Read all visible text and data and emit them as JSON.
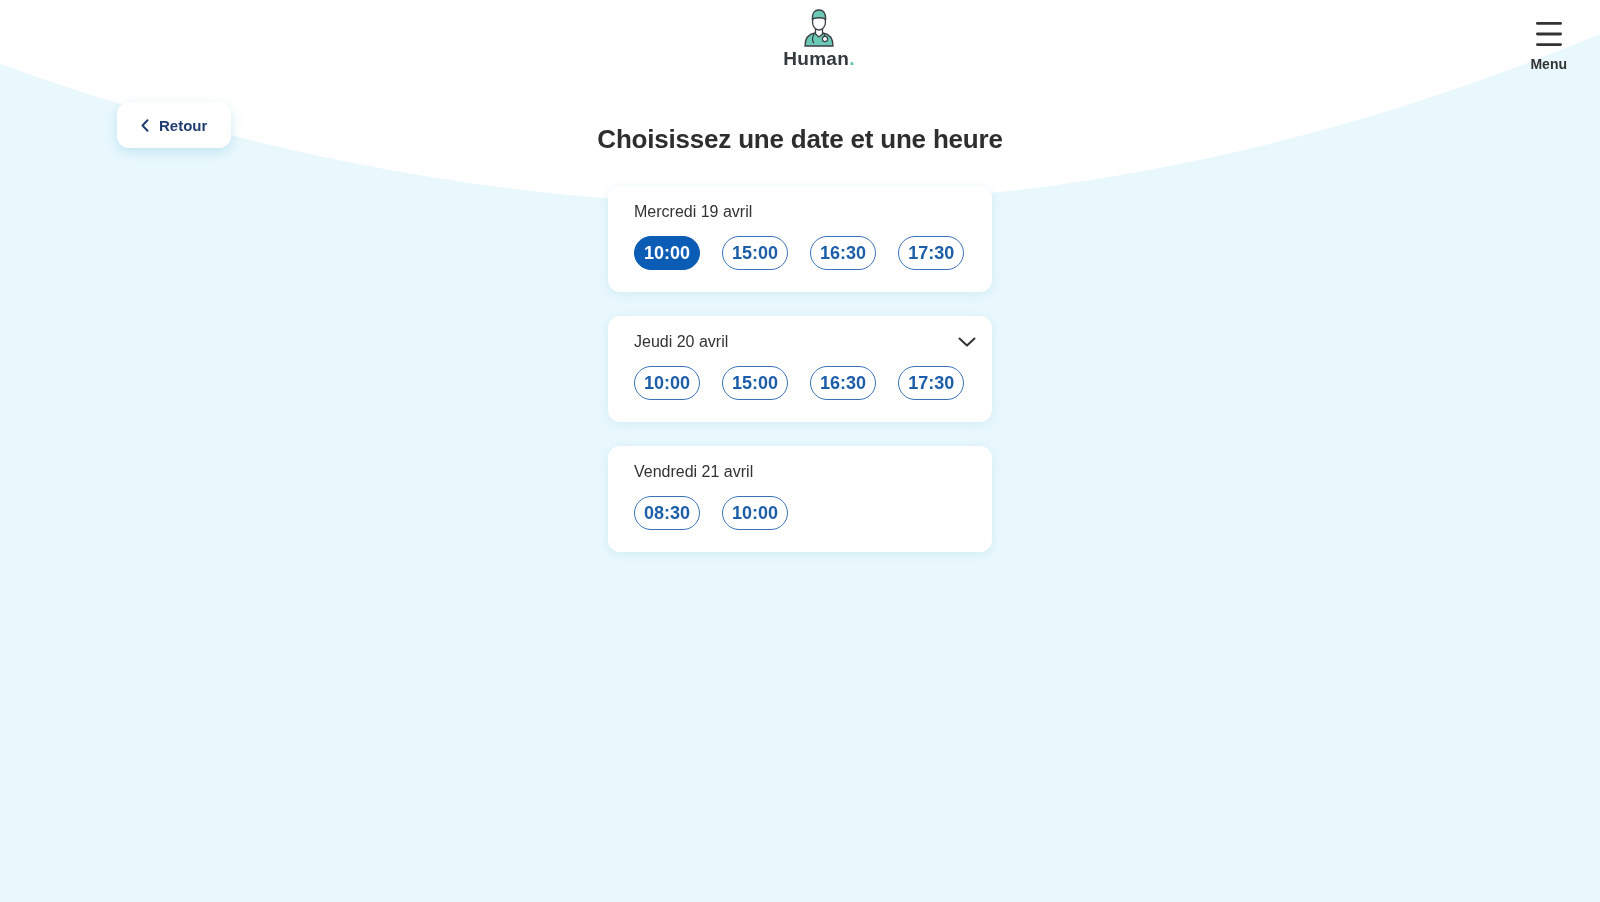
{
  "header": {
    "logo_text": "Human.",
    "menu_label": "Menu"
  },
  "back_button": {
    "label": "Retour"
  },
  "title": "Choisissez une date et une heure",
  "days": [
    {
      "label": "Mercredi 19 avril",
      "hovered": false,
      "slots": [
        {
          "time": "10:00",
          "selected": true
        },
        {
          "time": "15:00",
          "selected": false
        },
        {
          "time": "16:30",
          "selected": false
        },
        {
          "time": "17:30",
          "selected": false
        }
      ]
    },
    {
      "label": "Jeudi 20 avril",
      "hovered": true,
      "slots": [
        {
          "time": "10:00",
          "selected": false
        },
        {
          "time": "15:00",
          "selected": false
        },
        {
          "time": "16:30",
          "selected": false
        },
        {
          "time": "17:30",
          "selected": false
        }
      ]
    },
    {
      "label": "Vendredi 21 avril",
      "hovered": false,
      "slots": [
        {
          "time": "08:30",
          "selected": false
        },
        {
          "time": "10:00",
          "selected": false
        }
      ]
    }
  ]
}
